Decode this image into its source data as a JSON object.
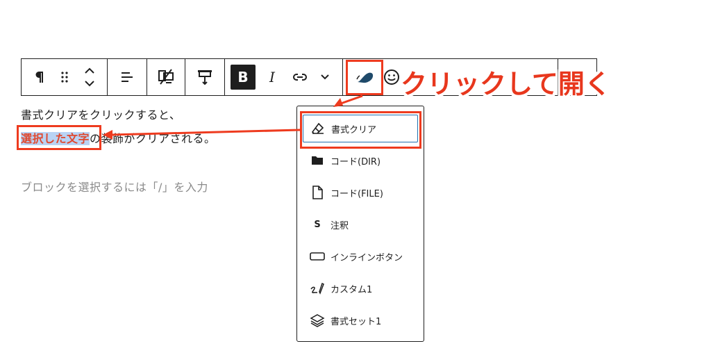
{
  "toolbar": {
    "bold_label": "B",
    "italic_label": "I",
    "paragraph_icon": "pilcrow-icon"
  },
  "editor": {
    "line1": "書式クリアをクリックすると、",
    "line2_selected": "選択した文字",
    "line2_rest": "の装飾がクリアされる。",
    "placeholder": "ブロックを選択するには「/」を入力"
  },
  "callout": {
    "text": "クリックして開く",
    "color": "#e8371d"
  },
  "dropdown": {
    "items": [
      {
        "label": "書式クリア",
        "icon": "eraser-icon"
      },
      {
        "label": "コード(DIR)",
        "icon": "folder-icon"
      },
      {
        "label": "コード(FILE)",
        "icon": "file-icon"
      },
      {
        "label": "注釈",
        "icon": "s-letter-icon",
        "icon_text": "S"
      },
      {
        "label": "インラインボタン",
        "icon": "button-outline-icon"
      },
      {
        "label": "カスタム1",
        "icon": "signature-icon"
      },
      {
        "label": "書式セット1",
        "icon": "layers-icon"
      }
    ]
  },
  "colors": {
    "annotation": "#ee3b1f",
    "selection_bg": "#b9d3f4",
    "focus": "#2271b1"
  }
}
